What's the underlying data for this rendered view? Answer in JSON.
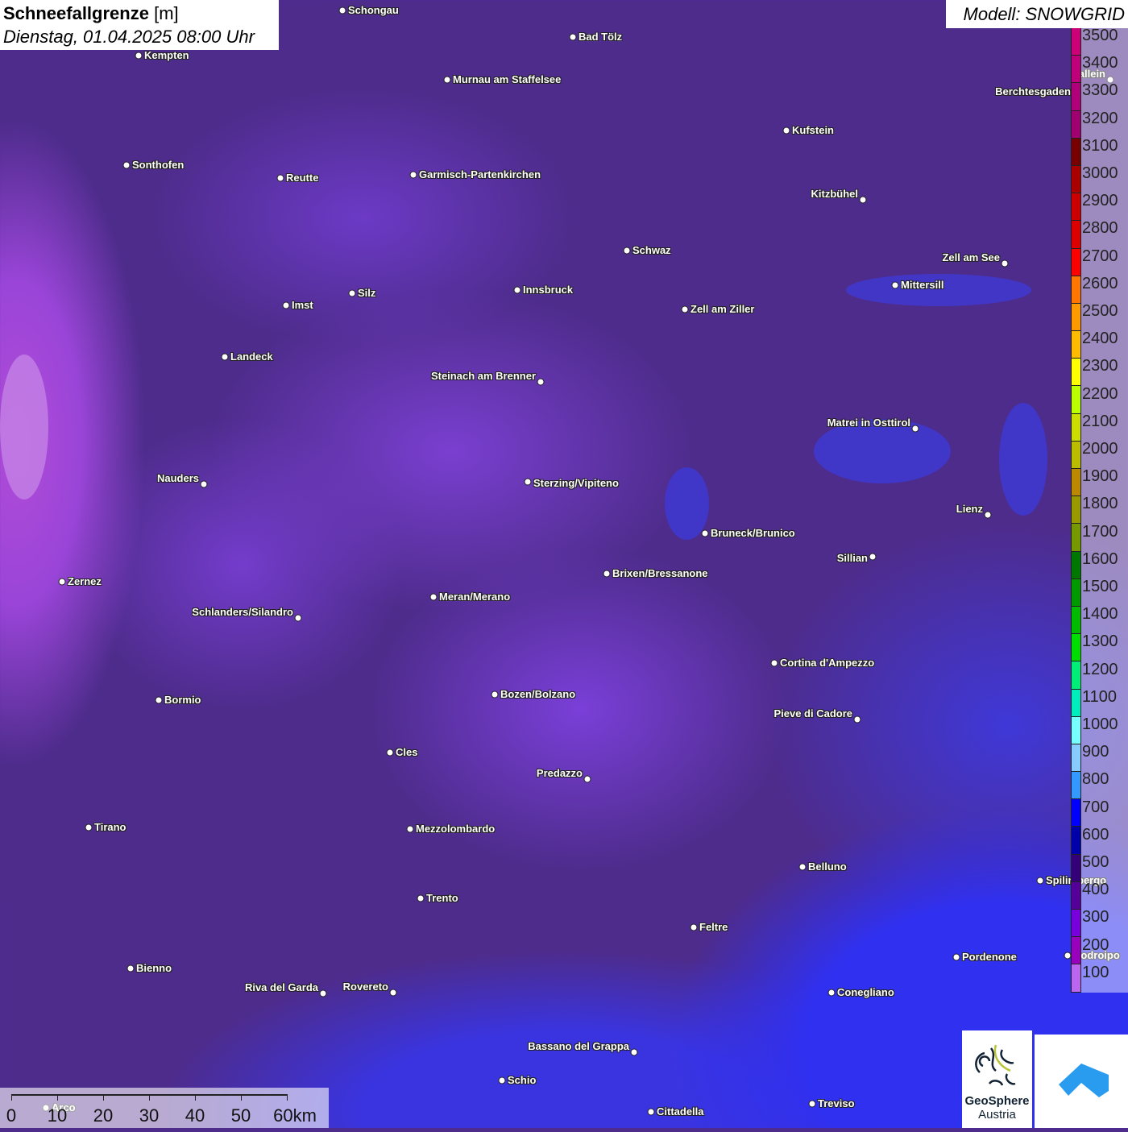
{
  "header": {
    "title": "Schneefallgrenze",
    "unit": "[m]",
    "datetime": "Dienstag, 01.04.2025 08:00 Uhr"
  },
  "model": "Modell: SNOWGRID",
  "legend": {
    "labels": [
      "3500",
      "3400",
      "3300",
      "3200",
      "3100",
      "3000",
      "2900",
      "2800",
      "2700",
      "2600",
      "2500",
      "2400",
      "2300",
      "2200",
      "2100",
      "2000",
      "1900",
      "1800",
      "1700",
      "1600",
      "1500",
      "1400",
      "1300",
      "1200",
      "1100",
      "1000",
      "900",
      "800",
      "700",
      "600",
      "500",
      "400",
      "300",
      "200",
      "100"
    ],
    "colors": [
      "#cc0077",
      "#c0007a",
      "#b0007a",
      "#a00070",
      "#770000",
      "#aa0000",
      "#cc0000",
      "#dd0000",
      "#ff0000",
      "#ff7700",
      "#ff9900",
      "#ffbb00",
      "#ffff00",
      "#bbff00",
      "#ccdd00",
      "#bbbb00",
      "#bb8800",
      "#999900",
      "#779900",
      "#007700",
      "#009900",
      "#00bb00",
      "#00dd00",
      "#00ee77",
      "#00eebb",
      "#77ffff",
      "#88ccff",
      "#3399ff",
      "#0000ff",
      "#0000aa",
      "#330077",
      "#550099",
      "#7700dd",
      "#9900bb",
      "#bb66ee"
    ]
  },
  "cities": [
    "Schongau",
    "Bad Tölz",
    "Kempten",
    "Murnau am Staffelsee",
    "Hallein",
    "Berchtesgaden",
    "Kufstein",
    "Sonthofen",
    "Reutte",
    "Garmisch-Partenkirchen",
    "Kitzbühel",
    "Schwaz",
    "Zell am See",
    "Innsbruck",
    "Silz",
    "Imst",
    "Mittersill",
    "Zell am Ziller",
    "Landeck",
    "Steinach am Brenner",
    "Matrei in Osttirol",
    "Nauders",
    "Sterzing/Vipiteno",
    "Lienz",
    "Bruneck/Brunico",
    "Sillian",
    "Brixen/Bressanone",
    "Zernez",
    "Meran/Merano",
    "Schlanders/Silandro",
    "Cortina d'Ampezzo",
    "Bozen/Bolzano",
    "Bormio",
    "Pieve di Cadore",
    "Cles",
    "Predazzo",
    "Tirano",
    "Mezzolombardo",
    "Belluno",
    "Spilimbergo",
    "Trento",
    "Feltre",
    "Pordenone",
    "Codroipo",
    "Bienno",
    "Riva del Garda",
    "Rovereto",
    "Conegliano",
    "Bassano del Grappa",
    "Schio",
    "Treviso",
    "Cittadella",
    "Arco"
  ],
  "scale": {
    "labels": [
      "0",
      "10",
      "20",
      "30",
      "40",
      "50",
      "60km"
    ]
  },
  "logos": {
    "geosphere": "GeoSphere",
    "geosphere_sub": "Austria"
  }
}
